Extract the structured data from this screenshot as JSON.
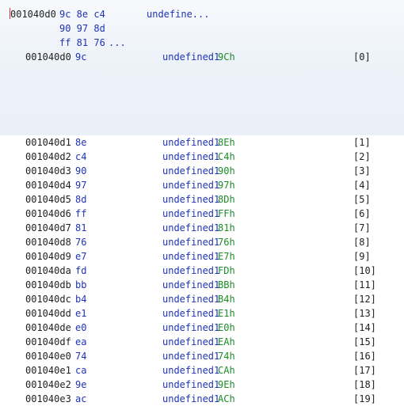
{
  "header": {
    "address": "001040d0",
    "bytes_line1": "9c 8e c4",
    "bytes_line2": "90 97 8d",
    "bytes_line3": "ff 81 76",
    "bytes_more": "...",
    "mnemonic": "undefine..."
  },
  "rows": [
    {
      "addr": "001040d0",
      "byte": "9c",
      "mnem": "undefined1",
      "val": "9Ch",
      "idx": "[0]"
    },
    {
      "addr": "001040d1",
      "byte": "8e",
      "mnem": "undefined1",
      "val": "8Eh",
      "idx": "[1]"
    },
    {
      "addr": "001040d2",
      "byte": "c4",
      "mnem": "undefined1",
      "val": "C4h",
      "idx": "[2]"
    },
    {
      "addr": "001040d3",
      "byte": "90",
      "mnem": "undefined1",
      "val": "90h",
      "idx": "[3]"
    },
    {
      "addr": "001040d4",
      "byte": "97",
      "mnem": "undefined1",
      "val": "97h",
      "idx": "[4]"
    },
    {
      "addr": "001040d5",
      "byte": "8d",
      "mnem": "undefined1",
      "val": "8Dh",
      "idx": "[5]"
    },
    {
      "addr": "001040d6",
      "byte": "ff",
      "mnem": "undefined1",
      "val": "FFh",
      "idx": "[6]"
    },
    {
      "addr": "001040d7",
      "byte": "81",
      "mnem": "undefined1",
      "val": "81h",
      "idx": "[7]"
    },
    {
      "addr": "001040d8",
      "byte": "76",
      "mnem": "undefined1",
      "val": "76h",
      "idx": "[8]"
    },
    {
      "addr": "001040d9",
      "byte": "e7",
      "mnem": "undefined1",
      "val": "E7h",
      "idx": "[9]"
    },
    {
      "addr": "001040da",
      "byte": "fd",
      "mnem": "undefined1",
      "val": "FDh",
      "idx": "[10]"
    },
    {
      "addr": "001040db",
      "byte": "bb",
      "mnem": "undefined1",
      "val": "BBh",
      "idx": "[11]"
    },
    {
      "addr": "001040dc",
      "byte": "b4",
      "mnem": "undefined1",
      "val": "B4h",
      "idx": "[12]"
    },
    {
      "addr": "001040dd",
      "byte": "e1",
      "mnem": "undefined1",
      "val": "E1h",
      "idx": "[13]"
    },
    {
      "addr": "001040de",
      "byte": "e0",
      "mnem": "undefined1",
      "val": "E0h",
      "idx": "[14]"
    },
    {
      "addr": "001040df",
      "byte": "ea",
      "mnem": "undefined1",
      "val": "EAh",
      "idx": "[15]"
    },
    {
      "addr": "001040e0",
      "byte": "74",
      "mnem": "undefined1",
      "val": "74h",
      "idx": "[16]"
    },
    {
      "addr": "001040e1",
      "byte": "ca",
      "mnem": "undefined1",
      "val": "CAh",
      "idx": "[17]"
    },
    {
      "addr": "001040e2",
      "byte": "9e",
      "mnem": "undefined1",
      "val": "9Eh",
      "idx": "[18]"
    },
    {
      "addr": "001040e3",
      "byte": "ac",
      "mnem": "undefined1",
      "val": "ACh",
      "idx": "[19]"
    }
  ],
  "colors": {
    "address": "#1f1f1f",
    "bytes": "#1e33b8",
    "value": "#1e8b2a",
    "cursor": "#d33"
  }
}
